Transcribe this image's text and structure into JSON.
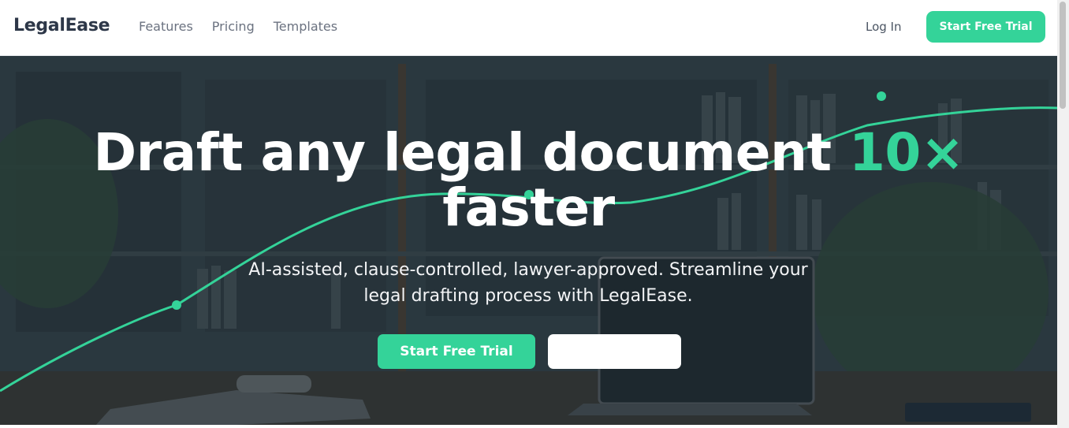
{
  "nav": {
    "brand": "LegalEase",
    "links": [
      {
        "label": "Features"
      },
      {
        "label": "Pricing"
      },
      {
        "label": "Templates"
      }
    ],
    "login_label": "Log In",
    "cta_label": "Start Free Trial"
  },
  "hero": {
    "title_line1": "Draft any legal document",
    "title_accent": "10×",
    "title_line2": "faster",
    "subtitle_line1": "AI-assisted, clause-controlled, lawyer-approved. Streamline your",
    "subtitle_line2": "legal drafting process with LegalEase.",
    "primary_cta": "Start Free Trial",
    "secondary_cta": ""
  },
  "colors": {
    "accent": "#34d399",
    "brand_text": "#2d3748",
    "nav_text": "#6b7280"
  }
}
